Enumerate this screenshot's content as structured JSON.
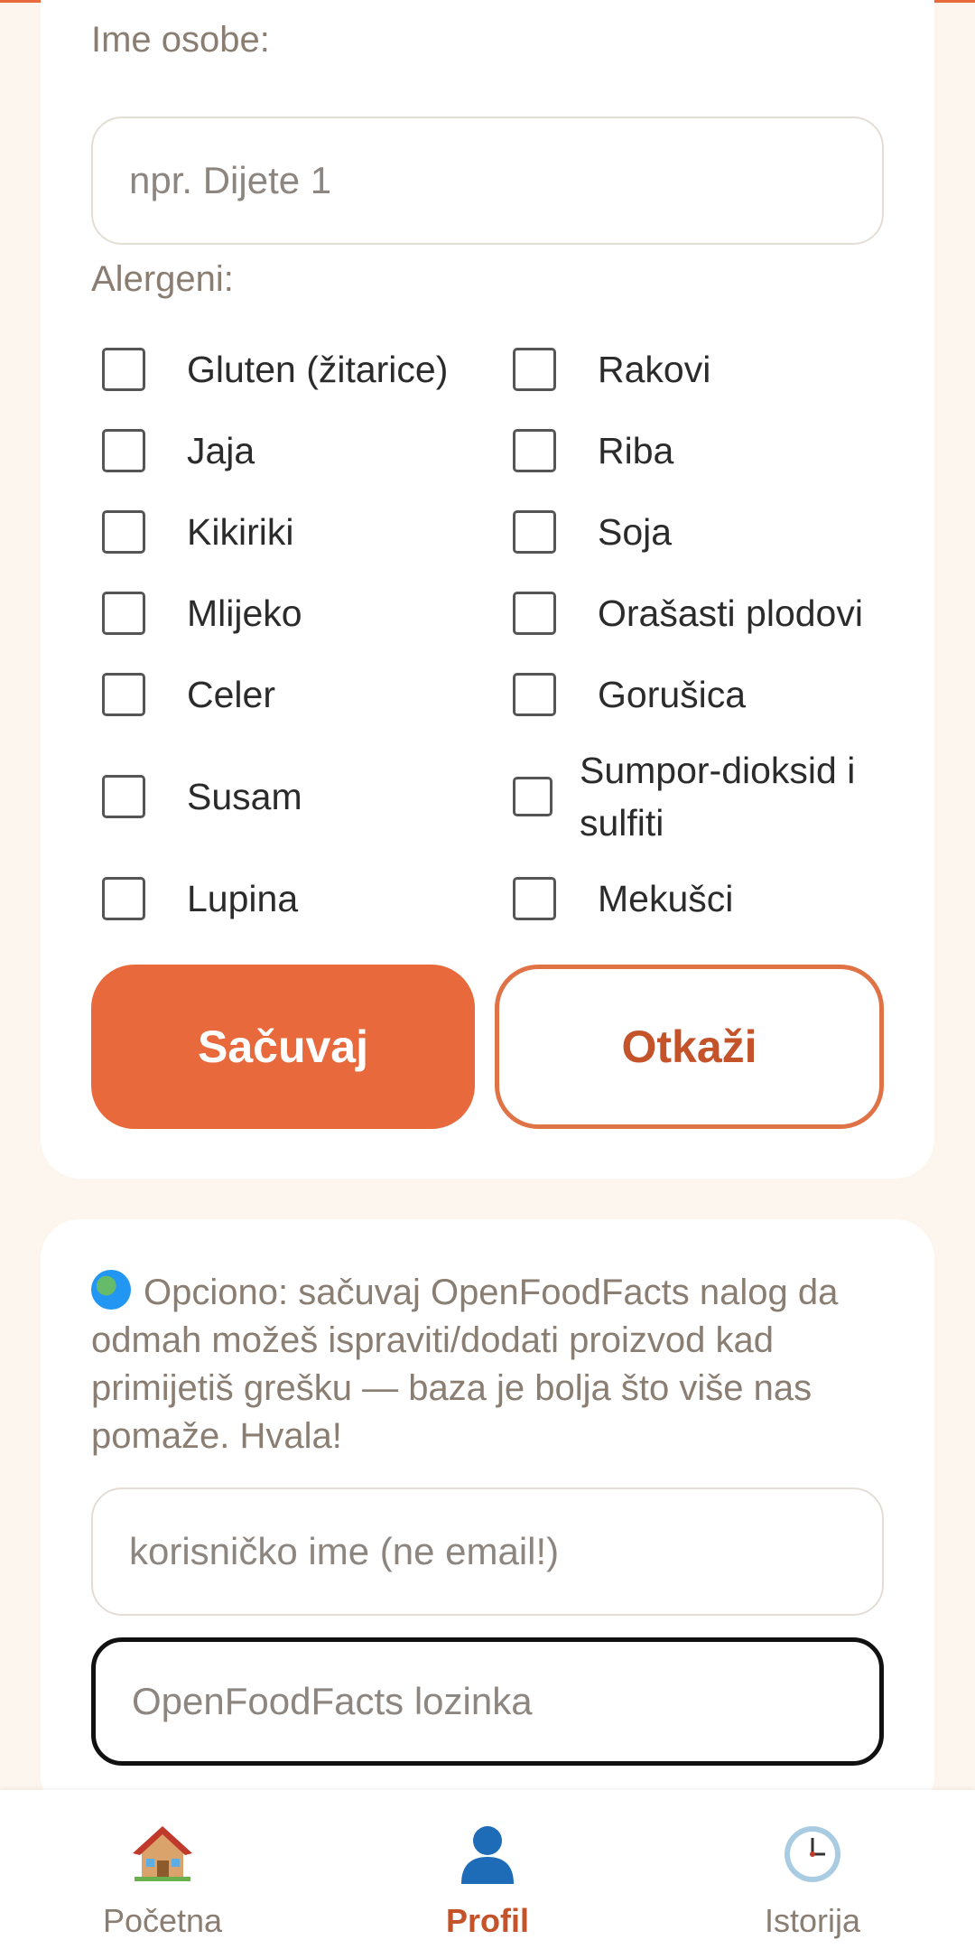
{
  "profile_form": {
    "name_label": "Ime osobe:",
    "name_placeholder": "npr. Dijete 1",
    "name_value": "",
    "allergens_label": "Alergeni:",
    "allergens": [
      {
        "label": "Gluten (žitarice)",
        "checked": false
      },
      {
        "label": "Rakovi",
        "checked": false
      },
      {
        "label": "Jaja",
        "checked": false
      },
      {
        "label": "Riba",
        "checked": false
      },
      {
        "label": "Kikiriki",
        "checked": false
      },
      {
        "label": "Soja",
        "checked": false
      },
      {
        "label": "Mlijeko",
        "checked": false
      },
      {
        "label": "Orašasti plodovi",
        "checked": false
      },
      {
        "label": "Celer",
        "checked": false
      },
      {
        "label": "Gorušica",
        "checked": false
      },
      {
        "label": "Susam",
        "checked": false
      },
      {
        "label": "Sumpor-dioksid i sulfiti",
        "checked": false
      },
      {
        "label": "Lupina",
        "checked": false
      },
      {
        "label": "Mekušci",
        "checked": false
      }
    ],
    "save_label": "Sačuvaj",
    "cancel_label": "Otkaži"
  },
  "off_account": {
    "info_icon": "globe-icon",
    "info_text": "Opciono: sačuvaj OpenFoodFacts nalog da odmah možeš ispraviti/dodati proizvod kad primijetiš grešku — baza je bolja što više nas pomaže. Hvala!",
    "username_placeholder": "korisničko ime (ne email!)",
    "password_placeholder": "OpenFoodFacts lozinka"
  },
  "bottom_nav": {
    "items": [
      {
        "label": "Početna",
        "icon": "house-icon",
        "active": false
      },
      {
        "label": "Profil",
        "icon": "person-icon",
        "active": true
      },
      {
        "label": "Istorija",
        "icon": "clock-icon",
        "active": false
      }
    ]
  },
  "colors": {
    "accent": "#e8693c",
    "accent_text": "#c4532a",
    "page_bg": "#fdf6ee",
    "muted_text": "#8a7d72"
  }
}
